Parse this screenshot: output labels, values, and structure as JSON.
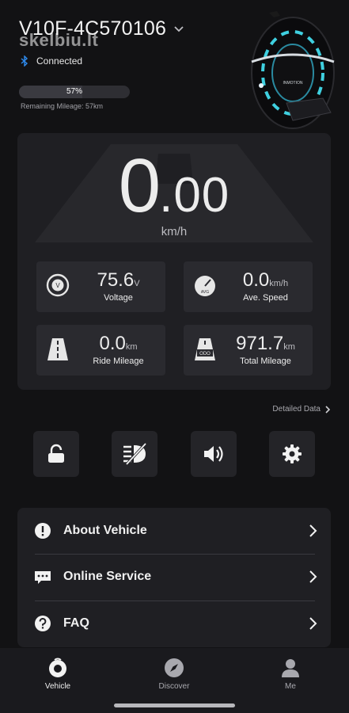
{
  "device": {
    "title": "V10F-4C570106",
    "status": "Connected",
    "battery_percent_text": "57%",
    "battery_level": 0.57,
    "remaining_mileage": "Remaining Mileage: 57km"
  },
  "watermark": "skelbiu.lt",
  "wheel_brand": "INMOTION",
  "dashboard": {
    "speed_int": "0",
    "speed_dot": ".",
    "speed_dec": "00",
    "speed_unit": "km/h",
    "stats": [
      {
        "value": "75.6",
        "unit": "V",
        "label": "Voltage",
        "icon": "voltage-gauge-icon",
        "icon_text": "V"
      },
      {
        "value": "0.0",
        "unit": "km/h",
        "label": "Ave. Speed",
        "icon": "speedometer-icon",
        "icon_text": "AVG"
      },
      {
        "value": "0.0",
        "unit": "km",
        "label": "Ride Mileage",
        "icon": "road-icon",
        "icon_text": ""
      },
      {
        "value": "971.7",
        "unit": "km",
        "label": "Total Mileage",
        "icon": "odometer-road-icon",
        "icon_text": "ODO"
      }
    ]
  },
  "detailed_data_label": "Detailed Data",
  "quick_actions": [
    {
      "name": "unlock-icon"
    },
    {
      "name": "headlight-off-icon"
    },
    {
      "name": "speaker-icon"
    },
    {
      "name": "gear-icon"
    }
  ],
  "menu": [
    {
      "label": "About Vehicle",
      "icon": "info-alert-icon"
    },
    {
      "label": "Online Service",
      "icon": "chat-bubble-icon"
    },
    {
      "label": "FAQ",
      "icon": "question-icon"
    }
  ],
  "tabs": [
    {
      "label": "Vehicle",
      "icon": "wheel-icon",
      "active": true
    },
    {
      "label": "Discover",
      "icon": "compass-icon",
      "active": false
    },
    {
      "label": "Me",
      "icon": "person-icon",
      "active": false
    }
  ],
  "colors": {
    "background": "#121214",
    "card": "#1f1f23",
    "tile": "#2a2a2f",
    "bluetooth": "#2f8cf0",
    "wheel_accent": "#3fd0e0"
  }
}
